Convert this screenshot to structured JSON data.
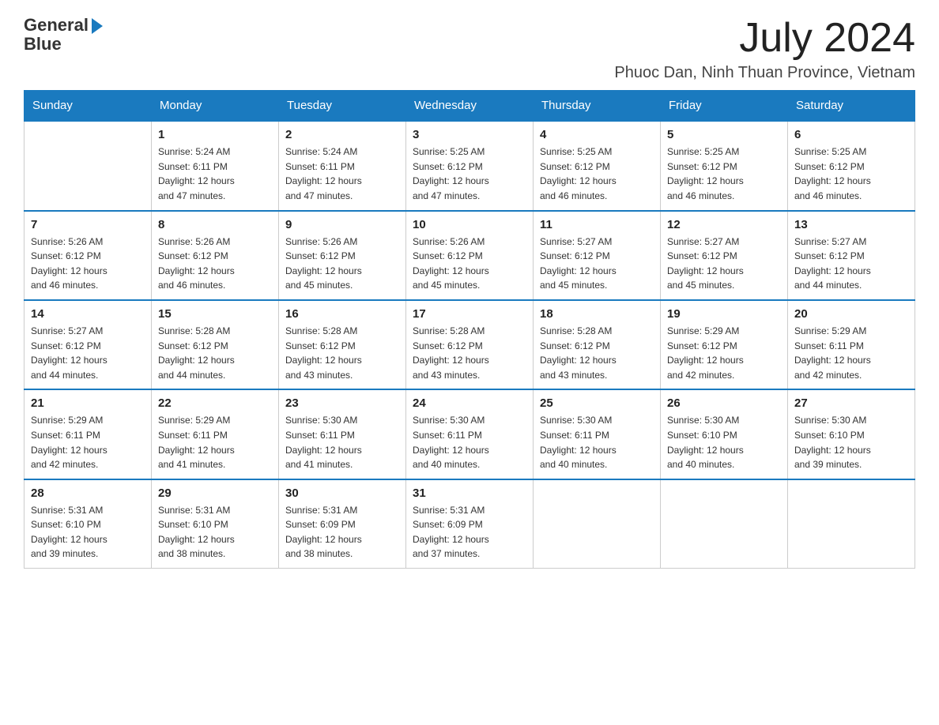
{
  "logo": {
    "line1": "General",
    "line2": "Blue"
  },
  "title": "July 2024",
  "location": "Phuoc Dan, Ninh Thuan Province, Vietnam",
  "days_of_week": [
    "Sunday",
    "Monday",
    "Tuesday",
    "Wednesday",
    "Thursday",
    "Friday",
    "Saturday"
  ],
  "weeks": [
    [
      {
        "day": "",
        "info": ""
      },
      {
        "day": "1",
        "info": "Sunrise: 5:24 AM\nSunset: 6:11 PM\nDaylight: 12 hours\nand 47 minutes."
      },
      {
        "day": "2",
        "info": "Sunrise: 5:24 AM\nSunset: 6:11 PM\nDaylight: 12 hours\nand 47 minutes."
      },
      {
        "day": "3",
        "info": "Sunrise: 5:25 AM\nSunset: 6:12 PM\nDaylight: 12 hours\nand 47 minutes."
      },
      {
        "day": "4",
        "info": "Sunrise: 5:25 AM\nSunset: 6:12 PM\nDaylight: 12 hours\nand 46 minutes."
      },
      {
        "day": "5",
        "info": "Sunrise: 5:25 AM\nSunset: 6:12 PM\nDaylight: 12 hours\nand 46 minutes."
      },
      {
        "day": "6",
        "info": "Sunrise: 5:25 AM\nSunset: 6:12 PM\nDaylight: 12 hours\nand 46 minutes."
      }
    ],
    [
      {
        "day": "7",
        "info": "Sunrise: 5:26 AM\nSunset: 6:12 PM\nDaylight: 12 hours\nand 46 minutes."
      },
      {
        "day": "8",
        "info": "Sunrise: 5:26 AM\nSunset: 6:12 PM\nDaylight: 12 hours\nand 46 minutes."
      },
      {
        "day": "9",
        "info": "Sunrise: 5:26 AM\nSunset: 6:12 PM\nDaylight: 12 hours\nand 45 minutes."
      },
      {
        "day": "10",
        "info": "Sunrise: 5:26 AM\nSunset: 6:12 PM\nDaylight: 12 hours\nand 45 minutes."
      },
      {
        "day": "11",
        "info": "Sunrise: 5:27 AM\nSunset: 6:12 PM\nDaylight: 12 hours\nand 45 minutes."
      },
      {
        "day": "12",
        "info": "Sunrise: 5:27 AM\nSunset: 6:12 PM\nDaylight: 12 hours\nand 45 minutes."
      },
      {
        "day": "13",
        "info": "Sunrise: 5:27 AM\nSunset: 6:12 PM\nDaylight: 12 hours\nand 44 minutes."
      }
    ],
    [
      {
        "day": "14",
        "info": "Sunrise: 5:27 AM\nSunset: 6:12 PM\nDaylight: 12 hours\nand 44 minutes."
      },
      {
        "day": "15",
        "info": "Sunrise: 5:28 AM\nSunset: 6:12 PM\nDaylight: 12 hours\nand 44 minutes."
      },
      {
        "day": "16",
        "info": "Sunrise: 5:28 AM\nSunset: 6:12 PM\nDaylight: 12 hours\nand 43 minutes."
      },
      {
        "day": "17",
        "info": "Sunrise: 5:28 AM\nSunset: 6:12 PM\nDaylight: 12 hours\nand 43 minutes."
      },
      {
        "day": "18",
        "info": "Sunrise: 5:28 AM\nSunset: 6:12 PM\nDaylight: 12 hours\nand 43 minutes."
      },
      {
        "day": "19",
        "info": "Sunrise: 5:29 AM\nSunset: 6:12 PM\nDaylight: 12 hours\nand 42 minutes."
      },
      {
        "day": "20",
        "info": "Sunrise: 5:29 AM\nSunset: 6:11 PM\nDaylight: 12 hours\nand 42 minutes."
      }
    ],
    [
      {
        "day": "21",
        "info": "Sunrise: 5:29 AM\nSunset: 6:11 PM\nDaylight: 12 hours\nand 42 minutes."
      },
      {
        "day": "22",
        "info": "Sunrise: 5:29 AM\nSunset: 6:11 PM\nDaylight: 12 hours\nand 41 minutes."
      },
      {
        "day": "23",
        "info": "Sunrise: 5:30 AM\nSunset: 6:11 PM\nDaylight: 12 hours\nand 41 minutes."
      },
      {
        "day": "24",
        "info": "Sunrise: 5:30 AM\nSunset: 6:11 PM\nDaylight: 12 hours\nand 40 minutes."
      },
      {
        "day": "25",
        "info": "Sunrise: 5:30 AM\nSunset: 6:11 PM\nDaylight: 12 hours\nand 40 minutes."
      },
      {
        "day": "26",
        "info": "Sunrise: 5:30 AM\nSunset: 6:10 PM\nDaylight: 12 hours\nand 40 minutes."
      },
      {
        "day": "27",
        "info": "Sunrise: 5:30 AM\nSunset: 6:10 PM\nDaylight: 12 hours\nand 39 minutes."
      }
    ],
    [
      {
        "day": "28",
        "info": "Sunrise: 5:31 AM\nSunset: 6:10 PM\nDaylight: 12 hours\nand 39 minutes."
      },
      {
        "day": "29",
        "info": "Sunrise: 5:31 AM\nSunset: 6:10 PM\nDaylight: 12 hours\nand 38 minutes."
      },
      {
        "day": "30",
        "info": "Sunrise: 5:31 AM\nSunset: 6:09 PM\nDaylight: 12 hours\nand 38 minutes."
      },
      {
        "day": "31",
        "info": "Sunrise: 5:31 AM\nSunset: 6:09 PM\nDaylight: 12 hours\nand 37 minutes."
      },
      {
        "day": "",
        "info": ""
      },
      {
        "day": "",
        "info": ""
      },
      {
        "day": "",
        "info": ""
      }
    ]
  ]
}
